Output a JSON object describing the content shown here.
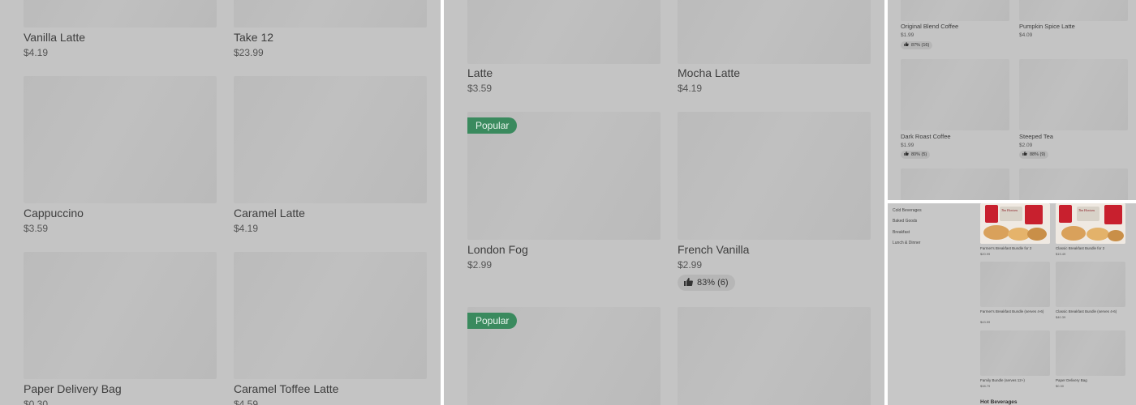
{
  "panel1": {
    "items": [
      {
        "name": "Vanilla Latte",
        "price": "$4.19"
      },
      {
        "name": "Take 12",
        "price": "$23.99"
      },
      {
        "name": "Cappuccino",
        "price": "$3.59"
      },
      {
        "name": "Caramel Latte",
        "price": "$4.19"
      },
      {
        "name": "Paper Delivery Bag",
        "price": "$0.30"
      },
      {
        "name": "Caramel Toffee Latte",
        "price": "$4.59"
      }
    ]
  },
  "panel2": {
    "badge_label": "Popular",
    "items": [
      {
        "name": "Latte",
        "price": "$3.59"
      },
      {
        "name": "Mocha Latte",
        "price": "$4.19"
      },
      {
        "name": "London Fog",
        "price": "$2.99"
      },
      {
        "name": "French Vanilla",
        "price": "$2.99",
        "rating": "83% (6)"
      }
    ]
  },
  "panel3": {
    "items": [
      {
        "name": "Original Blend Coffee",
        "price": "$1.99",
        "rating": "87% (16)"
      },
      {
        "name": "Pumpkin Spice Latte",
        "price": "$4.09"
      },
      {
        "name": "Dark Roast Coffee",
        "price": "$1.99",
        "rating": "80% (5)"
      },
      {
        "name": "Steeped Tea",
        "price": "$2.09",
        "rating": "88% (9)"
      }
    ]
  },
  "panel4": {
    "nav": [
      "Cold Beverages",
      "Baked Goods",
      "Breakfast",
      "Lunch & Dinner"
    ],
    "items": [
      {
        "name": "Farmer's Breakfast Bundle for 2",
        "price": "$20.99"
      },
      {
        "name": "Classic Breakfast Bundle for 2",
        "price": "$19.49"
      },
      {
        "name": "Farmer's Breakfast Bundle (serves 4-6)",
        "price": "$43.59"
      },
      {
        "name": "Classic Breakfast Bundle (serves 4-6)",
        "price": "$40.39"
      },
      {
        "name": "Family Bundle (serves 12+)",
        "price": "$38.79"
      },
      {
        "name": "Paper Delivery Bag",
        "price": "$0.30"
      }
    ],
    "section_title": "Hot Beverages",
    "brand_text": "Tim Hortons"
  },
  "colors": {
    "overlay": "#c4c4c4",
    "badge": "#3a8a5e",
    "placeholder": "#bbbbbb"
  },
  "icons": {
    "rating": "thumbs-up-icon"
  }
}
